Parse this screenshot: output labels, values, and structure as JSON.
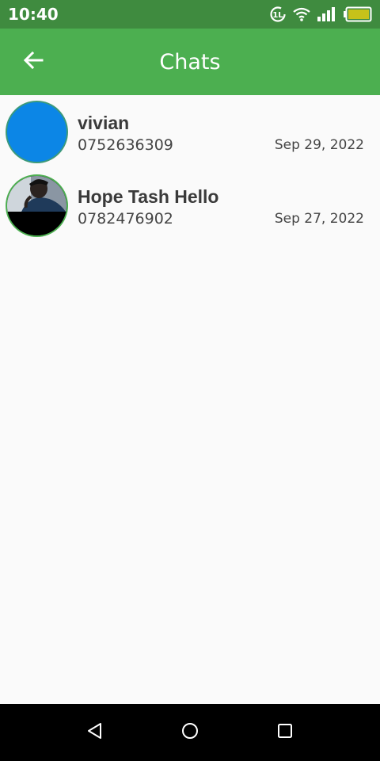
{
  "status_bar": {
    "time": "10:40",
    "icons": [
      "data-saver-icon",
      "wifi-icon",
      "signal-icon",
      "battery-icon"
    ],
    "battery_color": "#c6c21a"
  },
  "app_bar": {
    "title": "Chats",
    "back_icon": "arrow-left-icon",
    "color": "#4caf50"
  },
  "chats": [
    {
      "name": "vivian",
      "phone": "0752636309",
      "date": "Sep 29, 2022",
      "avatar": "blue-circle-placeholder",
      "avatar_color": "#0c86e6"
    },
    {
      "name": "Hope Tash Hello",
      "phone": "0782476902",
      "date": "Sep 27, 2022",
      "avatar": "profile-photo"
    }
  ],
  "nav_bar": {
    "buttons": [
      "back-triangle-icon",
      "home-circle-icon",
      "recents-square-icon"
    ]
  }
}
